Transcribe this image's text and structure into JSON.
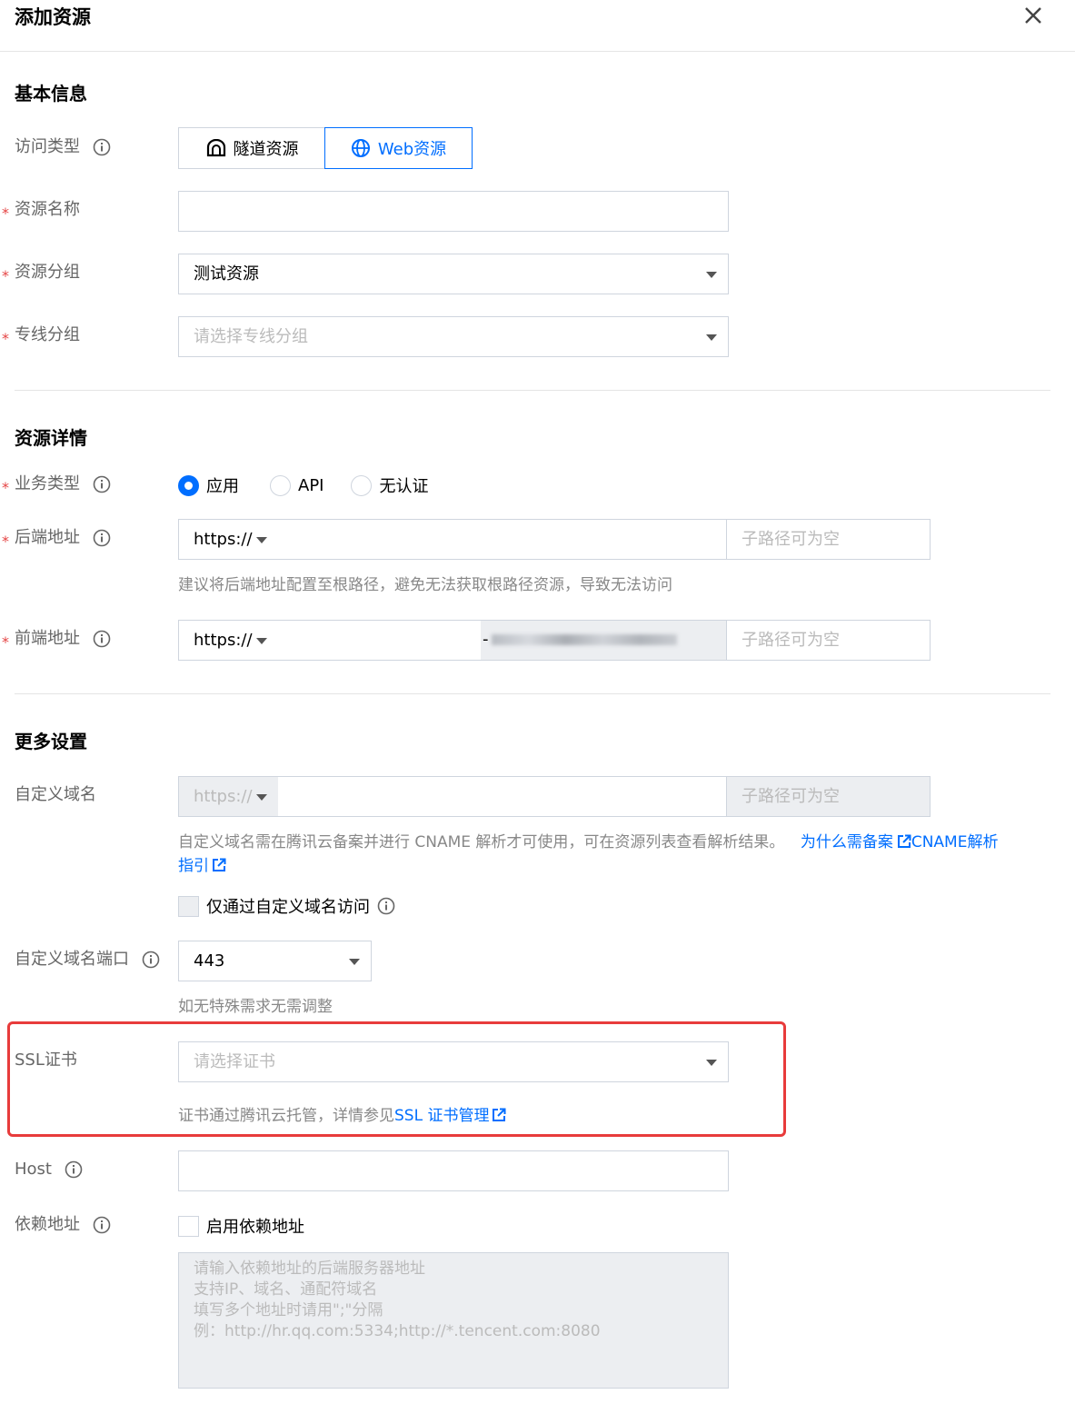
{
  "header": {
    "title": "添加资源"
  },
  "sections": {
    "basic": "基本信息",
    "detail": "资源详情",
    "more": "更多设置"
  },
  "access_type": {
    "label": "访问类型",
    "options": [
      "隧道资源",
      "Web资源"
    ],
    "selected": "Web资源"
  },
  "resource_name": {
    "label": "资源名称",
    "value": ""
  },
  "resource_group": {
    "label": "资源分组",
    "value": "测试资源"
  },
  "line_group": {
    "label": "专线分组",
    "placeholder": "请选择专线分组"
  },
  "business_type": {
    "label": "业务类型",
    "options": [
      "应用",
      "API",
      "无认证"
    ],
    "selected": "应用"
  },
  "backend": {
    "label": "后端地址",
    "protocol": "https://",
    "subpath_placeholder": "子路径可为空",
    "hint": "建议将后端地址配置至根路径，避免无法获取根路径资源，导致无法访问"
  },
  "frontend": {
    "label": "前端地址",
    "protocol": "https://",
    "suffix": "-",
    "subpath_placeholder": "子路径可为空"
  },
  "custom_domain": {
    "label": "自定义域名",
    "protocol": "https://",
    "subpath_placeholder": "子路径可为空",
    "hint": "自定义域名需在腾讯云备案并进行 CNAME 解析才可使用，可在资源列表查看解析结果。",
    "link1": "为什么需备案",
    "link2": "CNAME解析",
    "link2_cont": "指引",
    "only_custom": "仅通过自定义域名访问"
  },
  "custom_port": {
    "label": "自定义域名端口",
    "value": "443",
    "hint": "如无特殊需求无需调整"
  },
  "ssl": {
    "label": "SSL证书",
    "placeholder": "请选择证书",
    "hint": "证书通过腾讯云托管，详情参见",
    "link": "SSL 证书管理"
  },
  "host": {
    "label": "Host",
    "value": ""
  },
  "depend": {
    "label": "依赖地址",
    "checkbox": "启用依赖地址",
    "placeholder_lines": [
      "请输入依赖地址的后端服务器地址",
      "支持IP、域名、通配符域名",
      "填写多个地址时请用\";\"分隔",
      "例：http://hr.qq.com:5334;http://*.tencent.com:8080"
    ]
  },
  "colors": {
    "accent": "#006eff",
    "required": "#e54545",
    "highlight": "#e83b3b"
  }
}
